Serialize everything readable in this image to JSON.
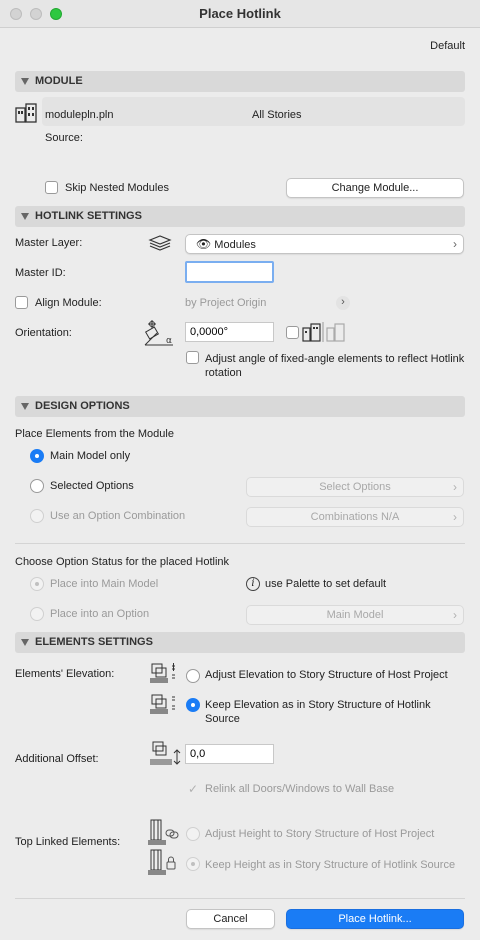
{
  "window": {
    "title": "Place Hotlink",
    "default_label": "Default"
  },
  "module": {
    "header": "MODULE",
    "file_name": "modulepln.pln",
    "stories": "All Stories",
    "source_label": "Source:",
    "skip_nested": "Skip Nested Modules",
    "change_module": "Change Module..."
  },
  "hotlink": {
    "header": "HOTLINK SETTINGS",
    "master_layer_label": "Master Layer:",
    "master_layer_value": "Modules",
    "master_id_label": "Master ID:",
    "master_id_value": "",
    "align_module": "Align Module:",
    "align_value": "by Project Origin",
    "orientation_label": "Orientation:",
    "orientation_value": "0,0000°",
    "adjust_angle": "Adjust angle of fixed-angle elements to reflect Hotlink rotation"
  },
  "design": {
    "header": "DESIGN OPTIONS",
    "place_elements_label": "Place Elements from the Module",
    "main_model_only": "Main Model only",
    "selected_options": "Selected Options",
    "select_options_btn": "Select Options",
    "use_combination": "Use an Option Combination",
    "combinations_btn": "Combinations N/A",
    "choose_status_label": "Choose Option Status for the placed Hotlink",
    "place_main": "Place into Main Model",
    "palette_note": "use Palette to set default",
    "place_option": "Place into an Option",
    "main_model_btn": "Main Model"
  },
  "elements": {
    "header": "ELEMENTS SETTINGS",
    "elevation_label": "Elements' Elevation:",
    "adjust_elevation": "Adjust Elevation to Story Structure of Host Project",
    "keep_elevation": "Keep Elevation as in Story Structure of Hotlink Source",
    "offset_label": "Additional Offset:",
    "offset_value": "0,0",
    "relink": "Relink all Doors/Windows to Wall Base",
    "top_linked_label": "Top Linked Elements:",
    "adjust_height": "Adjust Height to Story Structure of Host Project",
    "keep_height": "Keep Height as in Story Structure of Hotlink Source"
  },
  "footer": {
    "cancel": "Cancel",
    "place": "Place Hotlink..."
  },
  "colors": {
    "accent": "#1a7cf5",
    "close": "#d0d0d0",
    "zoom": "#2ec840"
  }
}
